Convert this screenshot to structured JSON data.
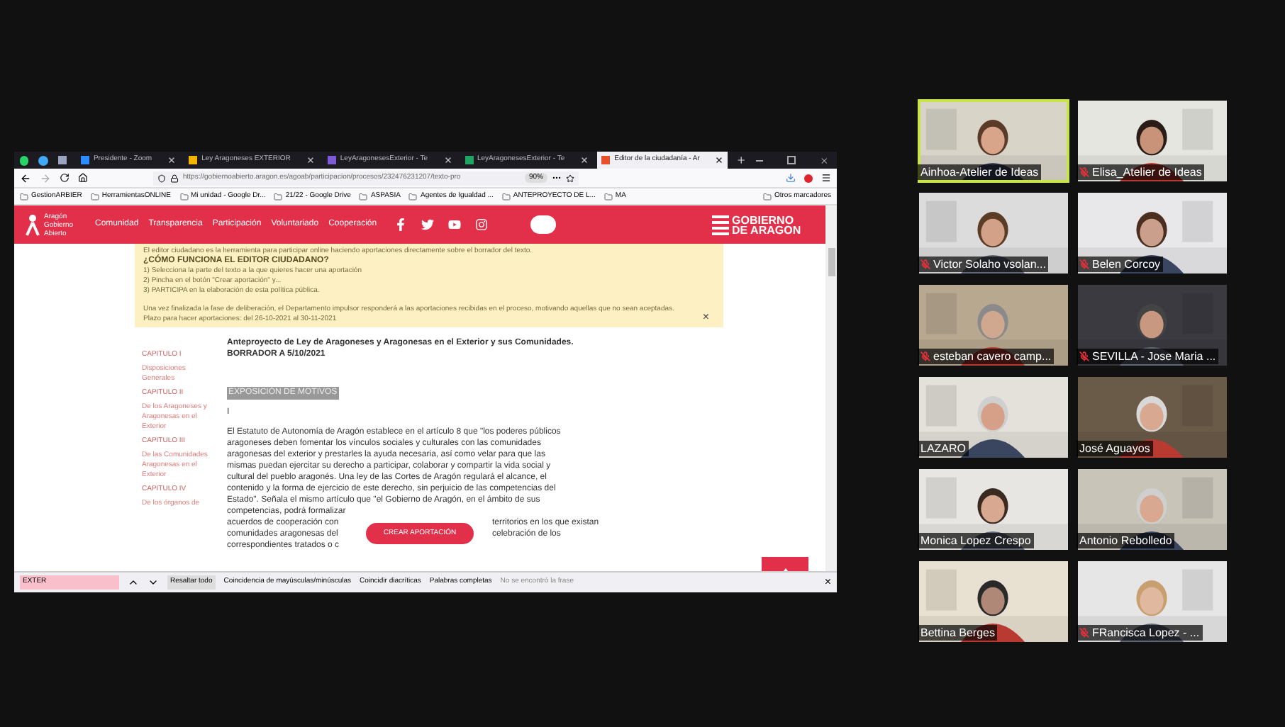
{
  "browser": {
    "tabs": [
      {
        "label": "Presidente - Zoom",
        "selected": false
      },
      {
        "label": "Ley Aragoneses EXTERIOR",
        "selected": false
      },
      {
        "label": "LeyAragonesesExterior - Te",
        "selected": false
      },
      {
        "label": "LeyAragonesesExterior - Te",
        "selected": false
      },
      {
        "label": "Editor de la ciudadanía - Ar",
        "selected": true
      }
    ],
    "url": "https://gobiernoabierto.aragon.es/agoab/participacion/procesos/232476231207/texto-pro",
    "zoom": "90%",
    "bookmarks": [
      "GestionARBIER",
      "HerramientasONLINE",
      "Mi unidad - Google Dr...",
      "21/22 - Google Drive",
      "ASPASIA",
      "Agentes de Igualdad ...",
      "ANTEPROYECTO DE L...",
      "MA"
    ],
    "other_bookmarks": "Otros marcadores"
  },
  "site": {
    "logo_text": "Aragón Gobierno Abierto",
    "nav": [
      "Comunidad",
      "Transparencia",
      "Participación",
      "Voluntariado",
      "Cooperación"
    ],
    "brand": "GOBIERNO DE ARAGON"
  },
  "notice": {
    "intro": "El editor ciudadano es la herramienta para participar online haciendo aportaciones directamente sobre el borrador del texto.",
    "heading": "¿CÓMO FUNCIONA EL EDITOR CIUDADANO?",
    "steps": [
      "1) Selecciona la parte del texto a la que quieres hacer una aportación",
      "2) Pincha en el botón \"Crear aportación\" y...",
      "3) PARTICIPA en la elaboración de esta política pública."
    ],
    "closing": "Una vez finalizada la fase de deliberación, el Departamento impulsor responderá a las aportaciones recibidas en el proceso, motivando aquellas que no sean aceptadas.",
    "deadline": "Plazo para hacer aportaciones: del 26-10-2021 al 30-11-2021",
    "close": "×"
  },
  "document": {
    "title": "Anteproyecto de Ley de Aragoneses y Aragonesas en el Exterior y sus Comunidades.",
    "subtitle": "BORRADOR A 5/10/2021",
    "sidebar": [
      {
        "text": "CAPITULO I",
        "kind": "chapter"
      },
      {
        "text": "Disposiciones Generales",
        "kind": "title"
      },
      {
        "text": "CAPITULO II",
        "kind": "chapter"
      },
      {
        "text": "De los Aragoneses y Aragonesas en el Exterior",
        "kind": "title"
      },
      {
        "text": "CAPITULO III",
        "kind": "chapter"
      },
      {
        "text": "De las Comunidades Aragonesas en el Exterior",
        "kind": "title"
      },
      {
        "text": "CAPITULO IV",
        "kind": "chapter"
      },
      {
        "text": "De los órganos de",
        "kind": "title"
      }
    ],
    "section_heading": "EXPOSICIÓN DE MOTIVOS",
    "roman": "I",
    "paragraph": "El Estatuto de Autonomía de Aragón establece en el artículo 8 que \"los poderes públicos aragoneses deben fomentar los vínculos sociales y culturales con las comunidades aragonesas del exterior y prestarles la ayuda necesaria, así como velar para que las mismas puedan ejercitar su derecho a participar, colaborar y compartir la vida social y cultural del pueblo aragonés. Una ley de las Cortes de Aragón regulará el alcance, el contenido y la forma de ejercicio de este derecho, sin perjuicio de las competencias del Estado\". Señala el mismo artículo que \"el Gobierno de Aragón, en el ámbito de sus competencias, podrá formalizar",
    "partial_lines": [
      {
        "left": "acuerdos de cooperación con",
        "right": "territorios en los que existan"
      },
      {
        "left": "comunidades aragonesas del",
        "right": "celebración de los"
      },
      {
        "left": "correspondientes tratados o c"
      }
    ]
  },
  "create_button": "CREAR APORTACIÓN",
  "find_bar": {
    "query": "EXTER",
    "not_found": true,
    "highlight_all": "Resaltar todo",
    "options": [
      "Coincidencia de mayúsculas/minúsculas",
      "Coincidir diacríticas",
      "Palabras completas"
    ],
    "status": "No se encontró la frase",
    "close": "×"
  },
  "participants": [
    {
      "name": "Ainhoa-Atelier de Ideas",
      "muted": false,
      "speaking": true
    },
    {
      "name": "Elisa_Atelier de Ideas",
      "muted": true,
      "speaking": false
    },
    {
      "name": "Victor Solaho vsolan...",
      "muted": true,
      "speaking": false
    },
    {
      "name": "Belen Corcoy",
      "muted": true,
      "speaking": false
    },
    {
      "name": "esteban cavero camp...",
      "muted": true,
      "speaking": false
    },
    {
      "name": "SEVILLA - Jose Maria ...",
      "muted": true,
      "speaking": false
    },
    {
      "name": "LAZARO",
      "muted": false,
      "speaking": false
    },
    {
      "name": "José Aguayos",
      "muted": false,
      "speaking": false
    },
    {
      "name": "Monica Lopez Crespo",
      "muted": false,
      "speaking": false
    },
    {
      "name": "Antonio Rebolledo",
      "muted": false,
      "speaking": false
    },
    {
      "name": "Bettina Berges",
      "muted": false,
      "speaking": false
    },
    {
      "name": "FRancisca Lopez - ...",
      "muted": true,
      "speaking": false
    }
  ]
}
